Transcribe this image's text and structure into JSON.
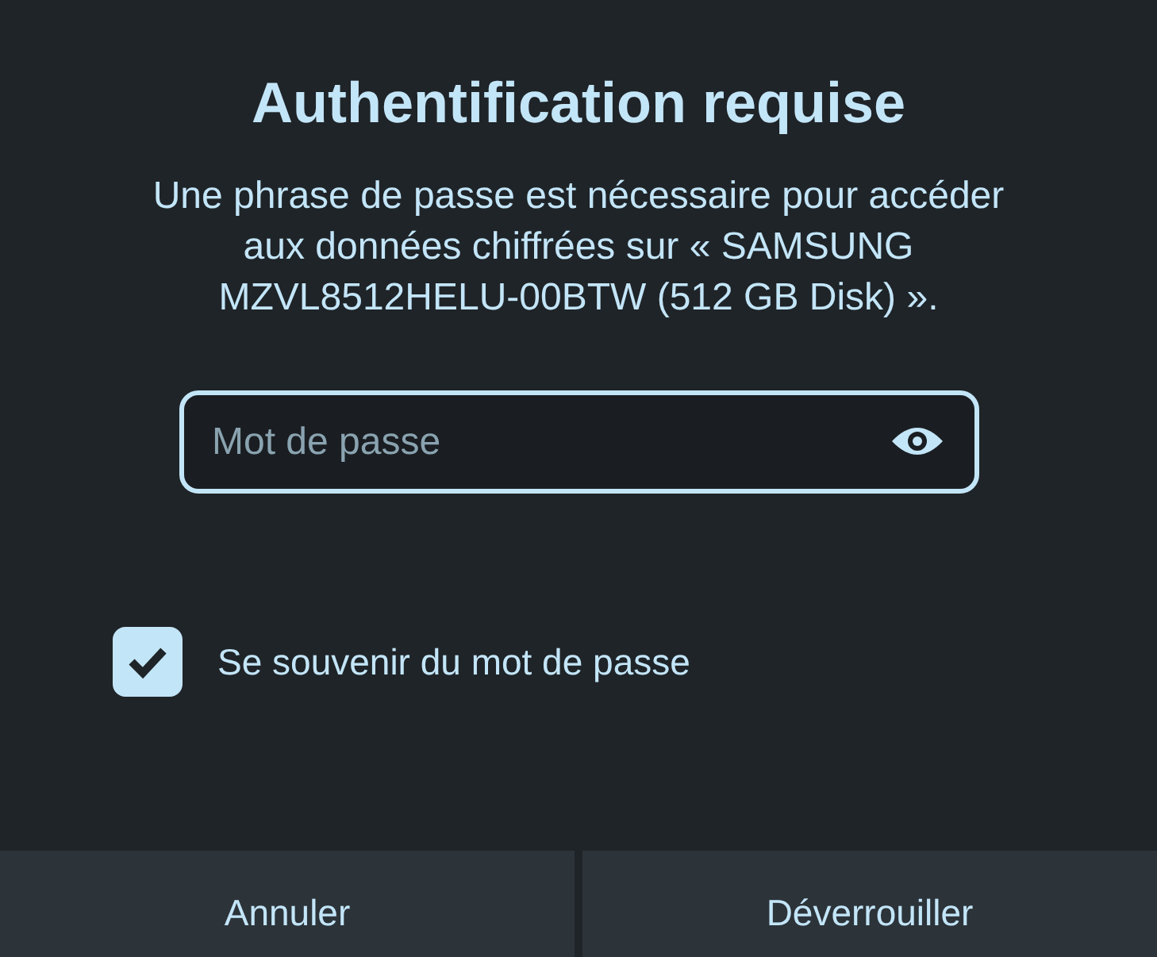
{
  "dialog": {
    "title": "Authentification requise",
    "message": "Une phrase de passe est nécessaire pour accéder aux données chiffrées sur « SAMSUNG MZVL8512HELU-00BTW (512 GB Disk) ».",
    "password_field": {
      "placeholder": "Mot de passe"
    },
    "remember": {
      "label": "Se souvenir du mot de passe",
      "checked": true
    },
    "buttons": [
      {
        "label": "Annuler"
      },
      {
        "label": "Déverrouiller"
      }
    ]
  }
}
